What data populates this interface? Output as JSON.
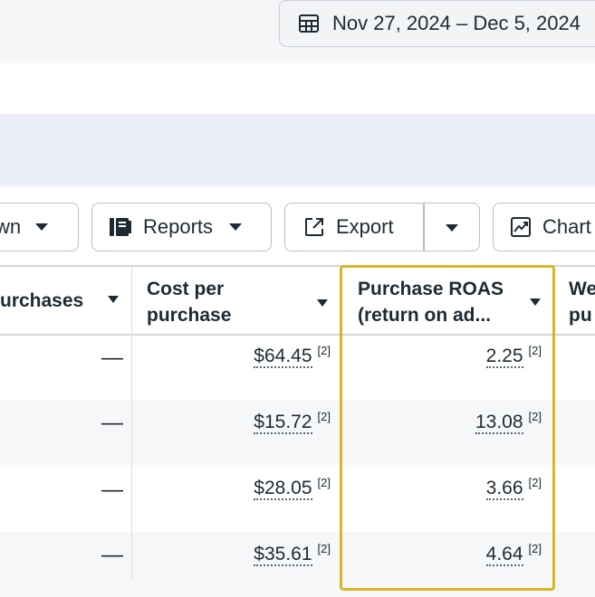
{
  "date_range": {
    "label": "Nov 27, 2024 – Dec 5, 2024"
  },
  "toolbar": {
    "breakdown_label": "wn",
    "reports_label": "Reports",
    "export_label": "Export",
    "chart_label": "Chart"
  },
  "columns": {
    "purchases": "urchases",
    "cost_per_purchase_line1": "Cost per",
    "cost_per_purchase_line2": "purchase",
    "roas_line1": "Purchase ROAS",
    "roas_line2": "(return on ad...",
    "next_line1": "We",
    "next_line2": "pu"
  },
  "rows": [
    {
      "purchases": "—",
      "cost_per_purchase": "$64.45",
      "cost_note": "[2]",
      "roas": "2.25",
      "roas_note": "[2]"
    },
    {
      "purchases": "—",
      "cost_per_purchase": "$15.72",
      "cost_note": "[2]",
      "roas": "13.08",
      "roas_note": "[2]"
    },
    {
      "purchases": "—",
      "cost_per_purchase": "$28.05",
      "cost_note": "[2]",
      "roas": "3.66",
      "roas_note": "[2]"
    },
    {
      "purchases": "—",
      "cost_per_purchase": "$35.61",
      "cost_note": "[2]",
      "roas": "4.64",
      "roas_note": "[2]"
    }
  ],
  "colors": {
    "highlight": "#d9b527",
    "accent_band": "#eceff9"
  }
}
